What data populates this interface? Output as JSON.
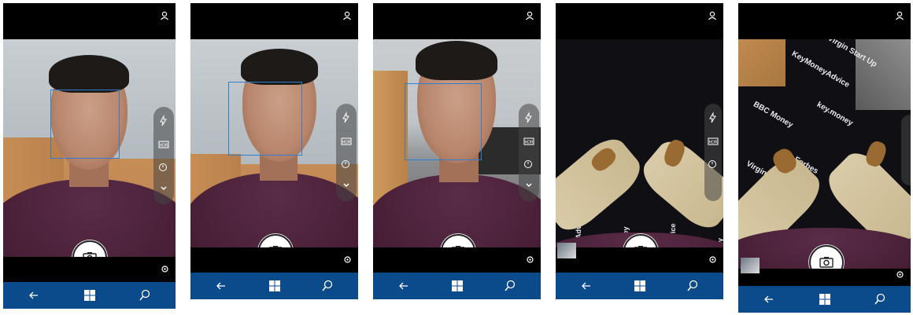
{
  "screens": [
    {
      "name": "selfie-1",
      "face_box": true,
      "scene": "face",
      "zoom": 1.0
    },
    {
      "name": "selfie-2",
      "face_box": true,
      "scene": "face",
      "zoom": 1.0
    },
    {
      "name": "selfie-3",
      "face_box": true,
      "scene": "face-kitchen",
      "zoom": 1.0
    },
    {
      "name": "floor-1",
      "face_box": false,
      "scene": "floor",
      "zoom": 1.0
    },
    {
      "name": "floor-2",
      "face_box": false,
      "scene": "floor-rotated",
      "zoom": 1.0
    }
  ],
  "floor_words": [
    "Virgin Start Up",
    "KeyMoneyAdvice",
    "key.money",
    "BBC Money",
    "Forbes"
  ],
  "icons": {
    "status": "person-icon",
    "flash": "flash-auto-icon",
    "hdr": "hdr-icon",
    "timer": "timer-icon",
    "expand": "chevron-down-icon",
    "shutter": "camera-icon",
    "video": "video-icon",
    "settings": "gear-icon",
    "back": "back-arrow-icon",
    "home": "windows-icon",
    "search": "search-icon"
  },
  "colors": {
    "navbar": "#0b4a8b",
    "face_box": "#2f7fd1",
    "sweater": "#4a2038"
  }
}
